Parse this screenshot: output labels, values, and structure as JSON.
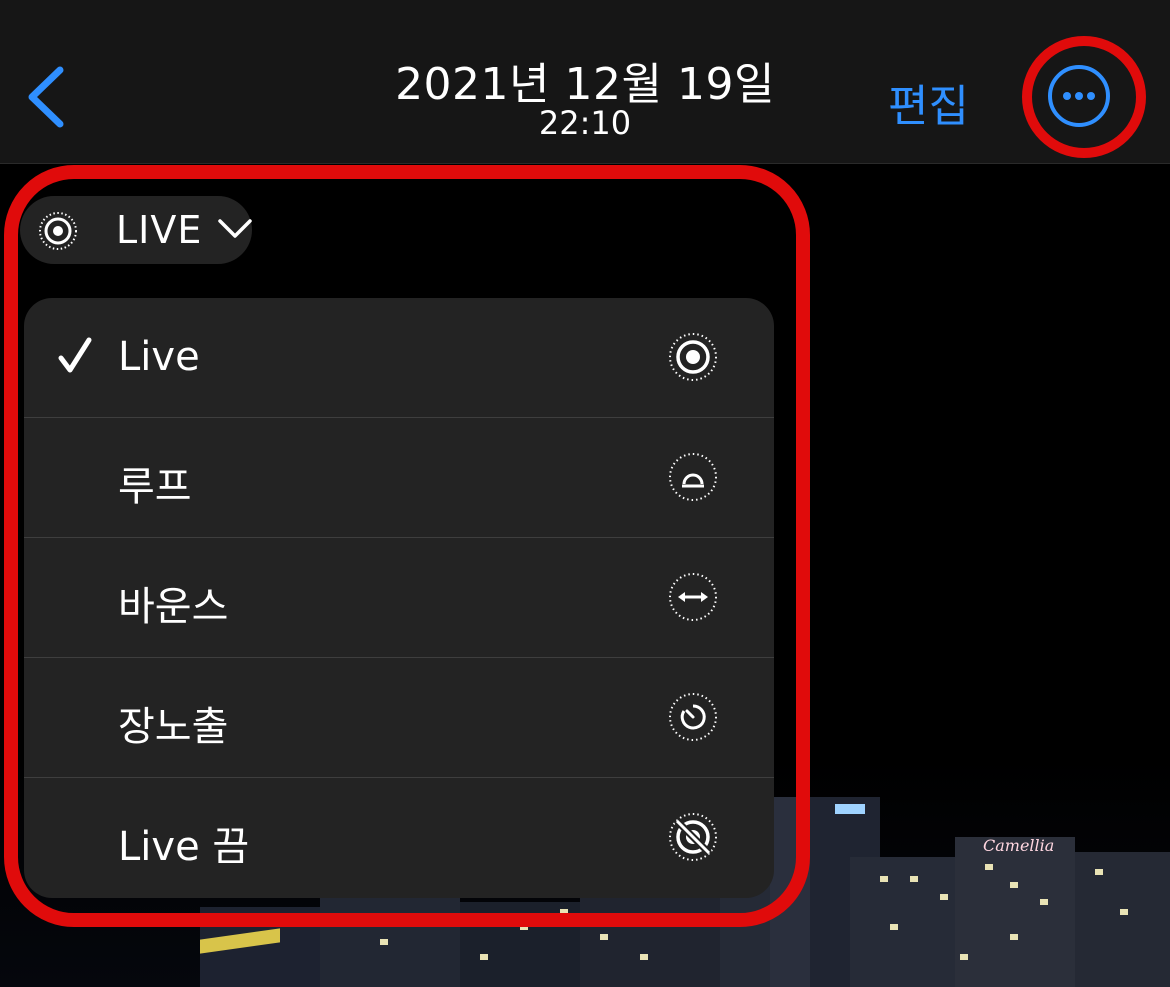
{
  "header": {
    "date": "2021년 12월 19일",
    "time": "22:10",
    "edit_label": "편집",
    "back_icon": "chevron-left-icon",
    "more_icon": "ellipsis-circle-icon"
  },
  "live_pill": {
    "label": "LIVE",
    "icon": "live-photo-icon",
    "chevron_icon": "chevron-down-icon"
  },
  "menu": {
    "items": [
      {
        "label": "Live",
        "icon": "live-photo-icon",
        "selected": true
      },
      {
        "label": "루프",
        "icon": "loop-icon",
        "selected": false
      },
      {
        "label": "바운스",
        "icon": "bounce-icon",
        "selected": false
      },
      {
        "label": "장노출",
        "icon": "long-exposure-icon",
        "selected": false
      },
      {
        "label": "Live 끔",
        "icon": "live-off-icon",
        "selected": false
      }
    ]
  },
  "photo": {
    "sign_text": "Camellia"
  },
  "colors": {
    "accent": "#2f8fff",
    "highlight": "#e00b0b",
    "menu_bg": "#232323"
  }
}
